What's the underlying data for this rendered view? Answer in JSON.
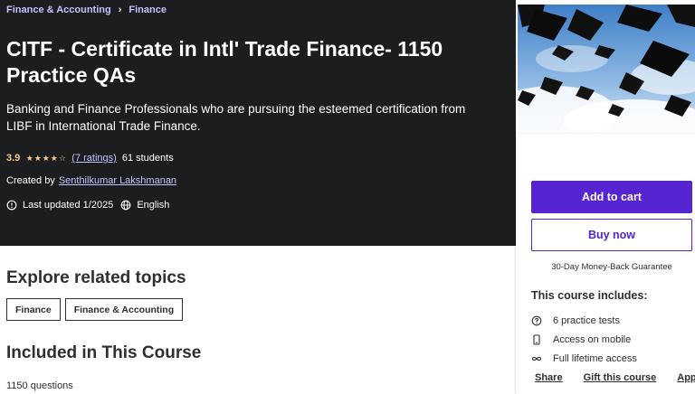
{
  "breadcrumb": {
    "items": [
      "Finance & Accounting",
      "Finance"
    ],
    "separator": "›"
  },
  "course": {
    "title": "CITF - Certificate in Intl' Trade Finance- 1150 Practice QAs",
    "subtitle": "Banking and Finance Professionals who are pursuing the esteemed certification from LIBF in International Trade Finance.",
    "rating": "3.9",
    "stars_filled": 4,
    "stars_total": 5,
    "ratings_text": "(7 ratings)",
    "students_text": "61 students",
    "created_by_label": "Created by",
    "author": "Senthilkumar Lakshmanan",
    "last_updated": "Last updated 1/2025",
    "language": "English"
  },
  "sidebar": {
    "add_to_cart": "Add to cart",
    "buy_now": "Buy now",
    "guarantee": "30-Day Money-Back Guarantee",
    "includes_title": "This course includes:",
    "includes": [
      {
        "icon": "quiz-icon",
        "label": "6 practice tests"
      },
      {
        "icon": "mobile-icon",
        "label": "Access on mobile"
      },
      {
        "icon": "infinity-icon",
        "label": "Full lifetime access"
      }
    ],
    "links": [
      "Share",
      "Gift this course",
      "Apply C"
    ]
  },
  "explore": {
    "title": "Explore related topics",
    "topics": [
      "Finance",
      "Finance & Accounting"
    ]
  },
  "included": {
    "title": "Included in This Course",
    "questions": "1150 questions"
  },
  "colors": {
    "hero_bg": "#1c1d1f",
    "accent_purple": "#5624d0",
    "link_lilac": "#c0c4fc",
    "star_gold": "#f3ca8c"
  }
}
